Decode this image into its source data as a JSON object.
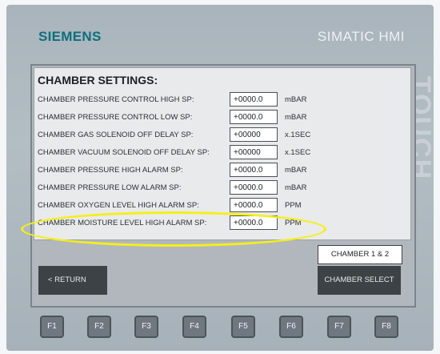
{
  "header": {
    "brand": "SIEMENS",
    "product": "SIMATIC HMI",
    "touch_text": "TOUCH"
  },
  "screen": {
    "title": "CHAMBER SETTINGS:",
    "rows": [
      {
        "label": "CHAMBER PRESSURE CONTROL HIGH SP:",
        "value": "+0000.0",
        "unit": "mBAR"
      },
      {
        "label": "CHAMBER PRESSURE CONTROL LOW SP:",
        "value": "+0000.0",
        "unit": "mBAR"
      },
      {
        "label": "CHAMBER GAS SOLENOID OFF DELAY SP:",
        "value": "+00000",
        "unit": "x.1SEC"
      },
      {
        "label": "CHAMBER VACUUM SOLENOID OFF DELAY SP:",
        "value": "+00000",
        "unit": "x.1SEC"
      },
      {
        "label": "CHAMBER PRESSURE HIGH ALARM SP:",
        "value": "+0000.0",
        "unit": "mBAR"
      },
      {
        "label": "CHAMBER PRESSURE LOW ALARM SP:",
        "value": "+0000.0",
        "unit": "mBAR"
      },
      {
        "label": "CHAMBER OXYGEN LEVEL HIGH ALARM SP:",
        "value": "+0000.0",
        "unit": "PPM"
      },
      {
        "label": "CHAMBER MOISTURE LEVEL HIGH ALARM SP:",
        "value": "+0000.0",
        "unit": "PPM"
      }
    ],
    "chamber_label": "CHAMBER 1 & 2",
    "return_button": "< RETURN",
    "chamber_select_button": "CHAMBER SELECT"
  },
  "function_keys": [
    "F1",
    "F2",
    "F3",
    "F4",
    "F5",
    "F6",
    "F7",
    "F8"
  ],
  "colors": {
    "highlight": "#f4ef1b",
    "brand": "#0e6f7a",
    "button_dark": "#3d4246"
  }
}
